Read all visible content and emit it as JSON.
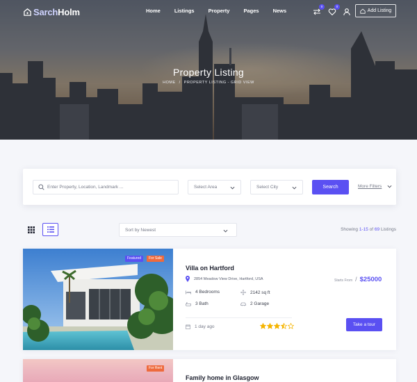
{
  "brand": {
    "name_part1": "Sarch",
    "name_part2": "Holm"
  },
  "nav": {
    "menu": [
      "Home",
      "Listings",
      "Property",
      "Pages",
      "News"
    ],
    "compare_count": "0",
    "wishlist_count": "0",
    "add_listing_label": "Add Listing"
  },
  "hero": {
    "title": "Property Listing",
    "breadcrumb_home": "HOME",
    "breadcrumb_sep": "/",
    "breadcrumb_current": "PROPERTY LISTING - GRID VIEW"
  },
  "search": {
    "placeholder": "Enter Property, Location, Landmark ...",
    "area_label": "Select Area",
    "city_label": "Select City",
    "button_label": "Search",
    "more_filters_label": "More Filters"
  },
  "toolbar": {
    "sort_label": "Sort by Newest",
    "showing_prefix": "Showing ",
    "showing_range": "1-15",
    "showing_of": " of ",
    "showing_total": "69",
    "showing_suffix": " Listings"
  },
  "listings": [
    {
      "title": "Villa on Hartford",
      "address": "2854 Meadow View Drive, Hartford, USA",
      "tags": [
        "Featured",
        "For Sale"
      ],
      "price_prefix": "Starts From",
      "price_sep": "/",
      "price": "$25000",
      "bedrooms": "4 Bedrooms",
      "area": "2142 sq ft",
      "baths": "3 Bath",
      "garage": "2 Garage",
      "posted": "1 day ago",
      "rating": 3.5,
      "cta": "Take a tour"
    },
    {
      "title": "Family home in Glasgow",
      "tags": [
        "For Rent"
      ]
    }
  ],
  "colors": {
    "accent": "#5a50f2",
    "tag_orange": "#ee6a3d"
  }
}
